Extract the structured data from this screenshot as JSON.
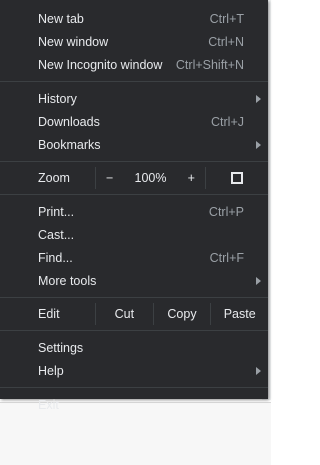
{
  "menu": {
    "group1": [
      {
        "label": "New tab",
        "shortcut": "Ctrl+T"
      },
      {
        "label": "New window",
        "shortcut": "Ctrl+N"
      },
      {
        "label": "New Incognito window",
        "shortcut": "Ctrl+Shift+N"
      }
    ],
    "group2": [
      {
        "label": "History",
        "submenu": true
      },
      {
        "label": "Downloads",
        "shortcut": "Ctrl+J"
      },
      {
        "label": "Bookmarks",
        "submenu": true
      }
    ],
    "zoom": {
      "label": "Zoom",
      "minus": "−",
      "value": "100%",
      "plus": "+",
      "fullscreen_icon": "fullscreen-icon"
    },
    "group3": [
      {
        "label": "Print...",
        "shortcut": "Ctrl+P"
      },
      {
        "label": "Cast..."
      },
      {
        "label": "Find...",
        "shortcut": "Ctrl+F"
      },
      {
        "label": "More tools",
        "submenu": true
      }
    ],
    "edit": {
      "label": "Edit",
      "cut": "Cut",
      "copy": "Copy",
      "paste": "Paste"
    },
    "group4": [
      {
        "label": "Settings"
      },
      {
        "label": "Help",
        "submenu": true
      }
    ],
    "group5": [
      {
        "label": "Exit"
      }
    ]
  },
  "colors": {
    "menu_bg": "#292a2d",
    "text": "#e8eaed",
    "shortcut": "#9aa0a6",
    "separator": "#3c4043"
  }
}
